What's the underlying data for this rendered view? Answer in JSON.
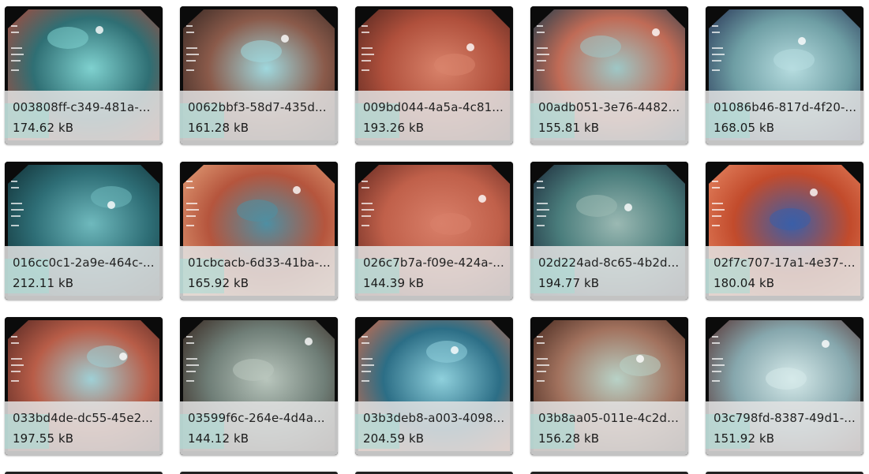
{
  "gallery": {
    "items": [
      {
        "filename": "003808ff-c349-481a-...",
        "size": "174.62 kB",
        "tone": [
          "#2f6f74",
          "#7fd1cf",
          "#a64a3c"
        ]
      },
      {
        "filename": "0062bbf3-58d7-435d...",
        "size": "161.28 kB",
        "tone": [
          "#8a5a4a",
          "#9fd8de",
          "#3a2a25"
        ]
      },
      {
        "filename": "009bd044-4a5a-4c81...",
        "size": "193.26 kB",
        "tone": [
          "#b0503c",
          "#d9836b",
          "#5b2a22"
        ]
      },
      {
        "filename": "00adb051-3e76-4482...",
        "size": "155.81 kB",
        "tone": [
          "#c06b56",
          "#9ec7c6",
          "#2c3f4c"
        ]
      },
      {
        "filename": "01086b46-817d-4f20-...",
        "size": "168.05 kB",
        "tone": [
          "#6e9ea4",
          "#b7dde0",
          "#2b3a5a"
        ]
      },
      {
        "filename": "016cc0c1-2a9e-464c-...",
        "size": "212.11 kB",
        "tone": [
          "#2e6e76",
          "#6fb9bd",
          "#133339"
        ]
      },
      {
        "filename": "01cbcacb-6d33-41ba-...",
        "size": "165.92 kB",
        "tone": [
          "#b5553d",
          "#4e8fa3",
          "#e09a74"
        ]
      },
      {
        "filename": "026c7b7a-f09e-424a-...",
        "size": "144.39 kB",
        "tone": [
          "#c0604a",
          "#d9806a",
          "#6b2d24"
        ]
      },
      {
        "filename": "02d224ad-8c65-4b2d...",
        "size": "194.77 kB",
        "tone": [
          "#4a7d7c",
          "#9bb9b3",
          "#1f2f3e"
        ]
      },
      {
        "filename": "02f7c707-17a1-4e37-a...",
        "size": "180.04 kB",
        "tone": [
          "#c24b2c",
          "#3b5fa8",
          "#e3825f"
        ]
      },
      {
        "filename": "033bd4de-dc55-45e2...",
        "size": "197.55 kB",
        "tone": [
          "#b85d48",
          "#9fd0d6",
          "#5a2a24"
        ]
      },
      {
        "filename": "03599f6c-264e-4d4a...",
        "size": "144.12 kB",
        "tone": [
          "#6f7e77",
          "#b9c6bd",
          "#3a2b24"
        ]
      },
      {
        "filename": "03b3deb8-a003-4098...",
        "size": "204.59 kB",
        "tone": [
          "#2c6e86",
          "#8fd0dc",
          "#c66a4e"
        ]
      },
      {
        "filename": "03b8aa05-011e-4c2d-...",
        "size": "156.28 kB",
        "tone": [
          "#a2725e",
          "#b8d2c7",
          "#4a2c22"
        ]
      },
      {
        "filename": "03c798fd-8387-49d1-...",
        "size": "151.92 kB",
        "tone": [
          "#86a7ad",
          "#d6eaea",
          "#5a3a3a"
        ]
      }
    ]
  }
}
